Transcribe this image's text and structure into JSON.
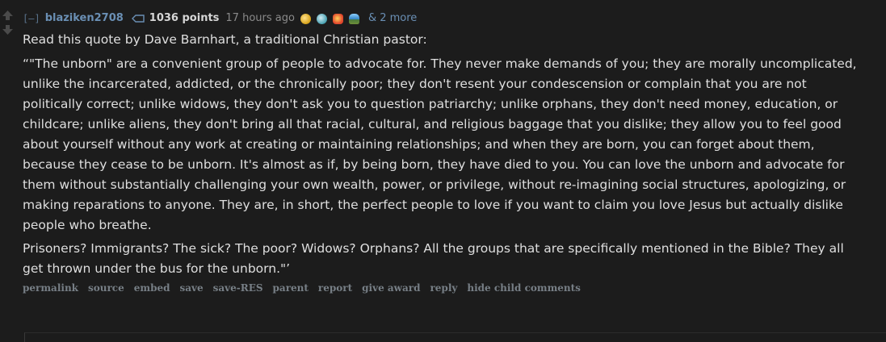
{
  "comment": {
    "expand_toggle": "[–]",
    "author": "blaziken2708",
    "points": "1036 points",
    "time": "17 hours ago",
    "awards": [
      "award-gold-icon",
      "award-wholesome-icon",
      "award-fire-icon",
      "award-beach-icon"
    ],
    "more_awards": "& 2 more",
    "paragraphs": [
      "Read this quote by Dave Barnhart, a traditional Christian pastor:",
      "“\"The unborn\" are a convenient group of people to advocate for. They never make demands of you; they are morally uncomplicated, unlike the incarcerated, addicted, or the chronically poor; they don't resent your condescension or complain that you are not politically correct; unlike widows, they don't ask you to question patriarchy; unlike orphans, they don't need money, education, or childcare; unlike aliens, they don't bring all that racial, cultural, and religious baggage that you dislike; they allow you to feel good about yourself without any work at creating or maintaining relationships; and when they are born, you can forget about them, because they cease to be unborn. It's almost as if, by being born, they have died to you. You can love the unborn and advocate for them without substantially challenging your own wealth, power, or privilege, without re-imagining social structures, apologizing, or making reparations to anyone. They are, in short, the perfect people to love if you want to claim you love Jesus but actually dislike people who breathe.",
      "Prisoners? Immigrants? The sick? The poor? Widows? Orphans? All the groups that are specifically mentioned in the Bible? They all get thrown under the bus for the unborn.\"’"
    ],
    "buttons": [
      "permalink",
      "source",
      "embed",
      "save",
      "save-RES",
      "parent",
      "report",
      "give award",
      "reply",
      "hide child comments"
    ]
  }
}
